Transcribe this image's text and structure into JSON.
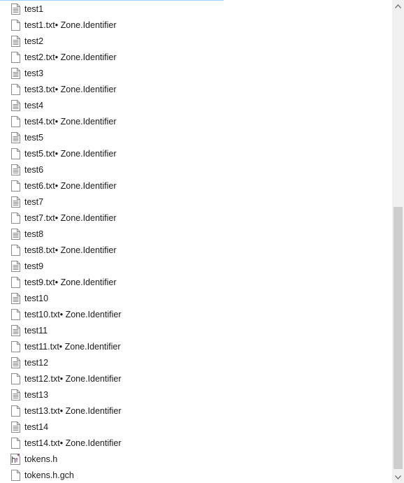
{
  "files": [
    {
      "name": "test1",
      "icon": "text-file-icon"
    },
    {
      "name": "test1.txt• Zone.Identifier",
      "icon": "blank-file-icon"
    },
    {
      "name": "test2",
      "icon": "text-file-icon"
    },
    {
      "name": "test2.txt• Zone.Identifier",
      "icon": "blank-file-icon"
    },
    {
      "name": "test3",
      "icon": "text-file-icon"
    },
    {
      "name": "test3.txt• Zone.Identifier",
      "icon": "blank-file-icon"
    },
    {
      "name": "test4",
      "icon": "text-file-icon"
    },
    {
      "name": "test4.txt• Zone.Identifier",
      "icon": "blank-file-icon"
    },
    {
      "name": "test5",
      "icon": "text-file-icon"
    },
    {
      "name": "test5.txt• Zone.Identifier",
      "icon": "blank-file-icon"
    },
    {
      "name": "test6",
      "icon": "text-file-icon"
    },
    {
      "name": "test6.txt• Zone.Identifier",
      "icon": "blank-file-icon"
    },
    {
      "name": "test7",
      "icon": "text-file-icon"
    },
    {
      "name": "test7.txt• Zone.Identifier",
      "icon": "blank-file-icon"
    },
    {
      "name": "test8",
      "icon": "text-file-icon"
    },
    {
      "name": "test8.txt• Zone.Identifier",
      "icon": "blank-file-icon"
    },
    {
      "name": "test9",
      "icon": "text-file-icon"
    },
    {
      "name": "test9.txt• Zone.Identifier",
      "icon": "blank-file-icon"
    },
    {
      "name": "test10",
      "icon": "text-file-icon"
    },
    {
      "name": "test10.txt• Zone.Identifier",
      "icon": "blank-file-icon"
    },
    {
      "name": "test11",
      "icon": "text-file-icon"
    },
    {
      "name": "test11.txt• Zone.Identifier",
      "icon": "blank-file-icon"
    },
    {
      "name": "test12",
      "icon": "text-file-icon"
    },
    {
      "name": "test12.txt• Zone.Identifier",
      "icon": "blank-file-icon"
    },
    {
      "name": "test13",
      "icon": "text-file-icon"
    },
    {
      "name": "test13.txt• Zone.Identifier",
      "icon": "blank-file-icon"
    },
    {
      "name": "test14",
      "icon": "text-file-icon"
    },
    {
      "name": "test14.txt• Zone.Identifier",
      "icon": "blank-file-icon"
    },
    {
      "name": "tokens.h",
      "icon": "c-header-file-icon"
    },
    {
      "name": "tokens.h.gch",
      "icon": "blank-file-icon"
    }
  ],
  "scrollbar": {
    "up_icon": "scroll-up-arrow-icon",
    "down_icon": "scroll-down-arrow-icon",
    "scroll_position": 0.9
  },
  "colors": {
    "selection_line": "#99d1ff",
    "scrollbar_track": "#f0f0f0",
    "scrollbar_thumb": "#cdcdcd",
    "c_header_accent": "#a05a9c"
  }
}
